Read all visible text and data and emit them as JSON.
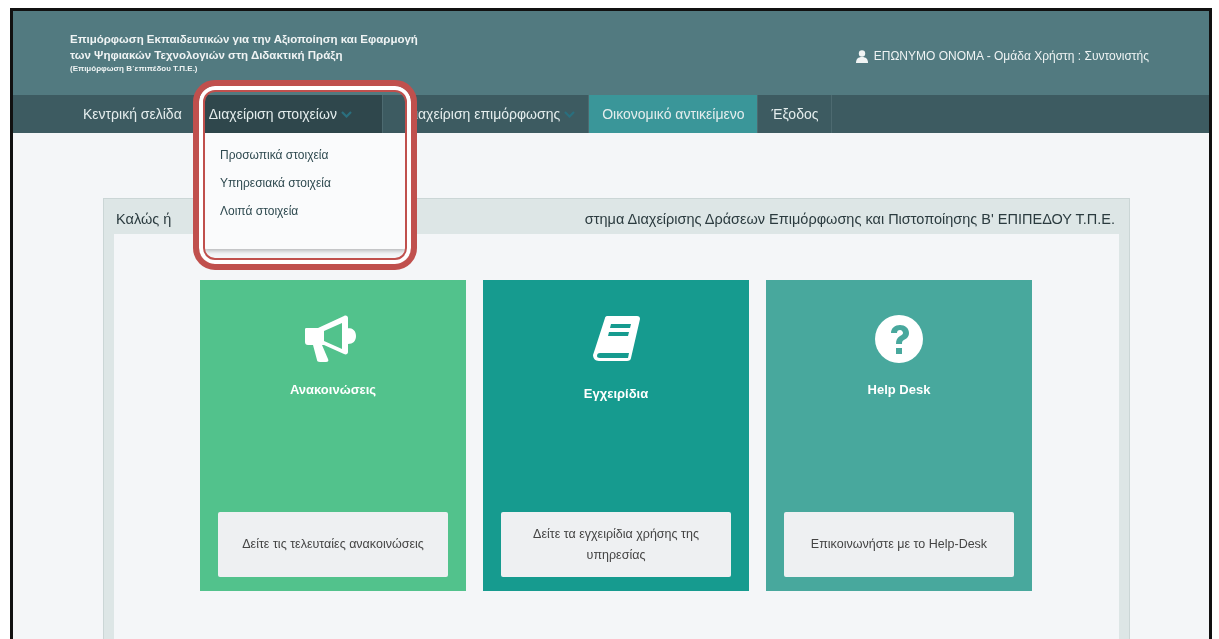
{
  "header": {
    "title_lines": [
      "Επιμόρφωση Εκπαιδευτικών για την Αξιοποίηση και Εφαρμογή",
      "των Ψηφιακών Τεχνολογιών στη Διδακτική Πράξη"
    ],
    "subtitle": "(Επιμόρφωση Β΄επιπέδου Τ.Π.Ε.)",
    "user": "ΕΠΩΝΥΜΟ ΟΝΟΜΑ - Ομάδα Χρήστη : Συντονιστής"
  },
  "nav": [
    {
      "label": "Κεντρική σελίδα",
      "kind": "link",
      "selected": false,
      "expanded": false
    },
    {
      "label": "Διαχείριση στοιχείων",
      "kind": "dropdown",
      "selected": false,
      "expanded": true
    },
    {
      "label": "ιαχείριση επιμόρφωσης",
      "kind": "dropdown",
      "selected": false,
      "expanded": false
    },
    {
      "label": "Οικονομικό αντικείμενο",
      "kind": "link",
      "selected": true,
      "expanded": false
    },
    {
      "label": "Έξοδος",
      "kind": "link",
      "selected": false,
      "expanded": false
    }
  ],
  "dropdown_menu": {
    "items": [
      "Προσωπικά στοιχεία",
      "Υπηρεσιακά στοιχεία",
      "Λοιπά στοιχεία"
    ]
  },
  "welcome": {
    "visible_start": "Καλώς ή",
    "visible_end": "στημα Διαχείρισης Δράσεων Επιμόρφωσης και Πιστοποίησης Β' ΕΠΙΠΕΔΟΥ Τ.Π.Ε."
  },
  "cards": [
    {
      "title": "Ανακοινώσεις",
      "color": "#52c28c",
      "button": "Δείτε τις τελευταίες ανακοινώσεις"
    },
    {
      "title": "Εγχειρίδια",
      "color": "#169b8f",
      "button": "Δείτε τα εγχειρίδια χρήσης της υπηρεσίας"
    },
    {
      "title": "Help Desk",
      "color": "#48a89d",
      "button": "Επικοινωνήστε με το Help-Desk"
    }
  ]
}
